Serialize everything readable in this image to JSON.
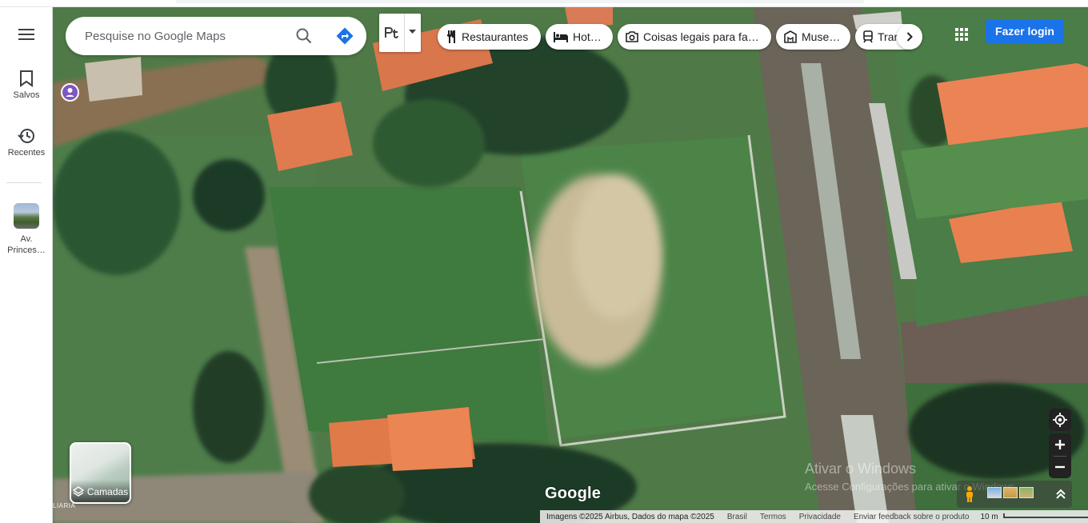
{
  "search": {
    "placeholder": "Pesquise no Google Maps"
  },
  "sidebar": {
    "items": [
      {
        "label": "Salvos",
        "icon": "bookmark-icon"
      },
      {
        "label": "Recentes",
        "icon": "history-icon"
      },
      {
        "label": "Av.\nPrinces…",
        "icon": "place-thumbnail"
      }
    ]
  },
  "transit_icon": "public-transit-icon",
  "chips": [
    {
      "label": "Restaurantes",
      "icon": "restaurant-icon"
    },
    {
      "label": "Hotéis",
      "icon": "hotel-icon"
    },
    {
      "label": "Coisas legais para fa…",
      "icon": "camera-icon"
    },
    {
      "label": "Museus",
      "icon": "museum-icon"
    },
    {
      "label": "Tran",
      "icon": "transit-icon"
    }
  ],
  "login_label": "Fazer login",
  "layers_label": "Camadas",
  "map_corner_text": "LIARIA",
  "google_logo": "Google",
  "attribution": {
    "imagery": "Imagens ©2025 Airbus, Dados do mapa ©2025",
    "country": "Brasil",
    "terms": "Termos",
    "privacy": "Privacidade",
    "feedback": "Enviar feedback sobre o produto",
    "scale": "10 m"
  },
  "watermark": {
    "title": "Ativar o Windows",
    "subtitle": "Acesse Configurações para ativar o Windows."
  },
  "colors": {
    "accent": "#1a73e8",
    "pin": "#7e57c2"
  }
}
